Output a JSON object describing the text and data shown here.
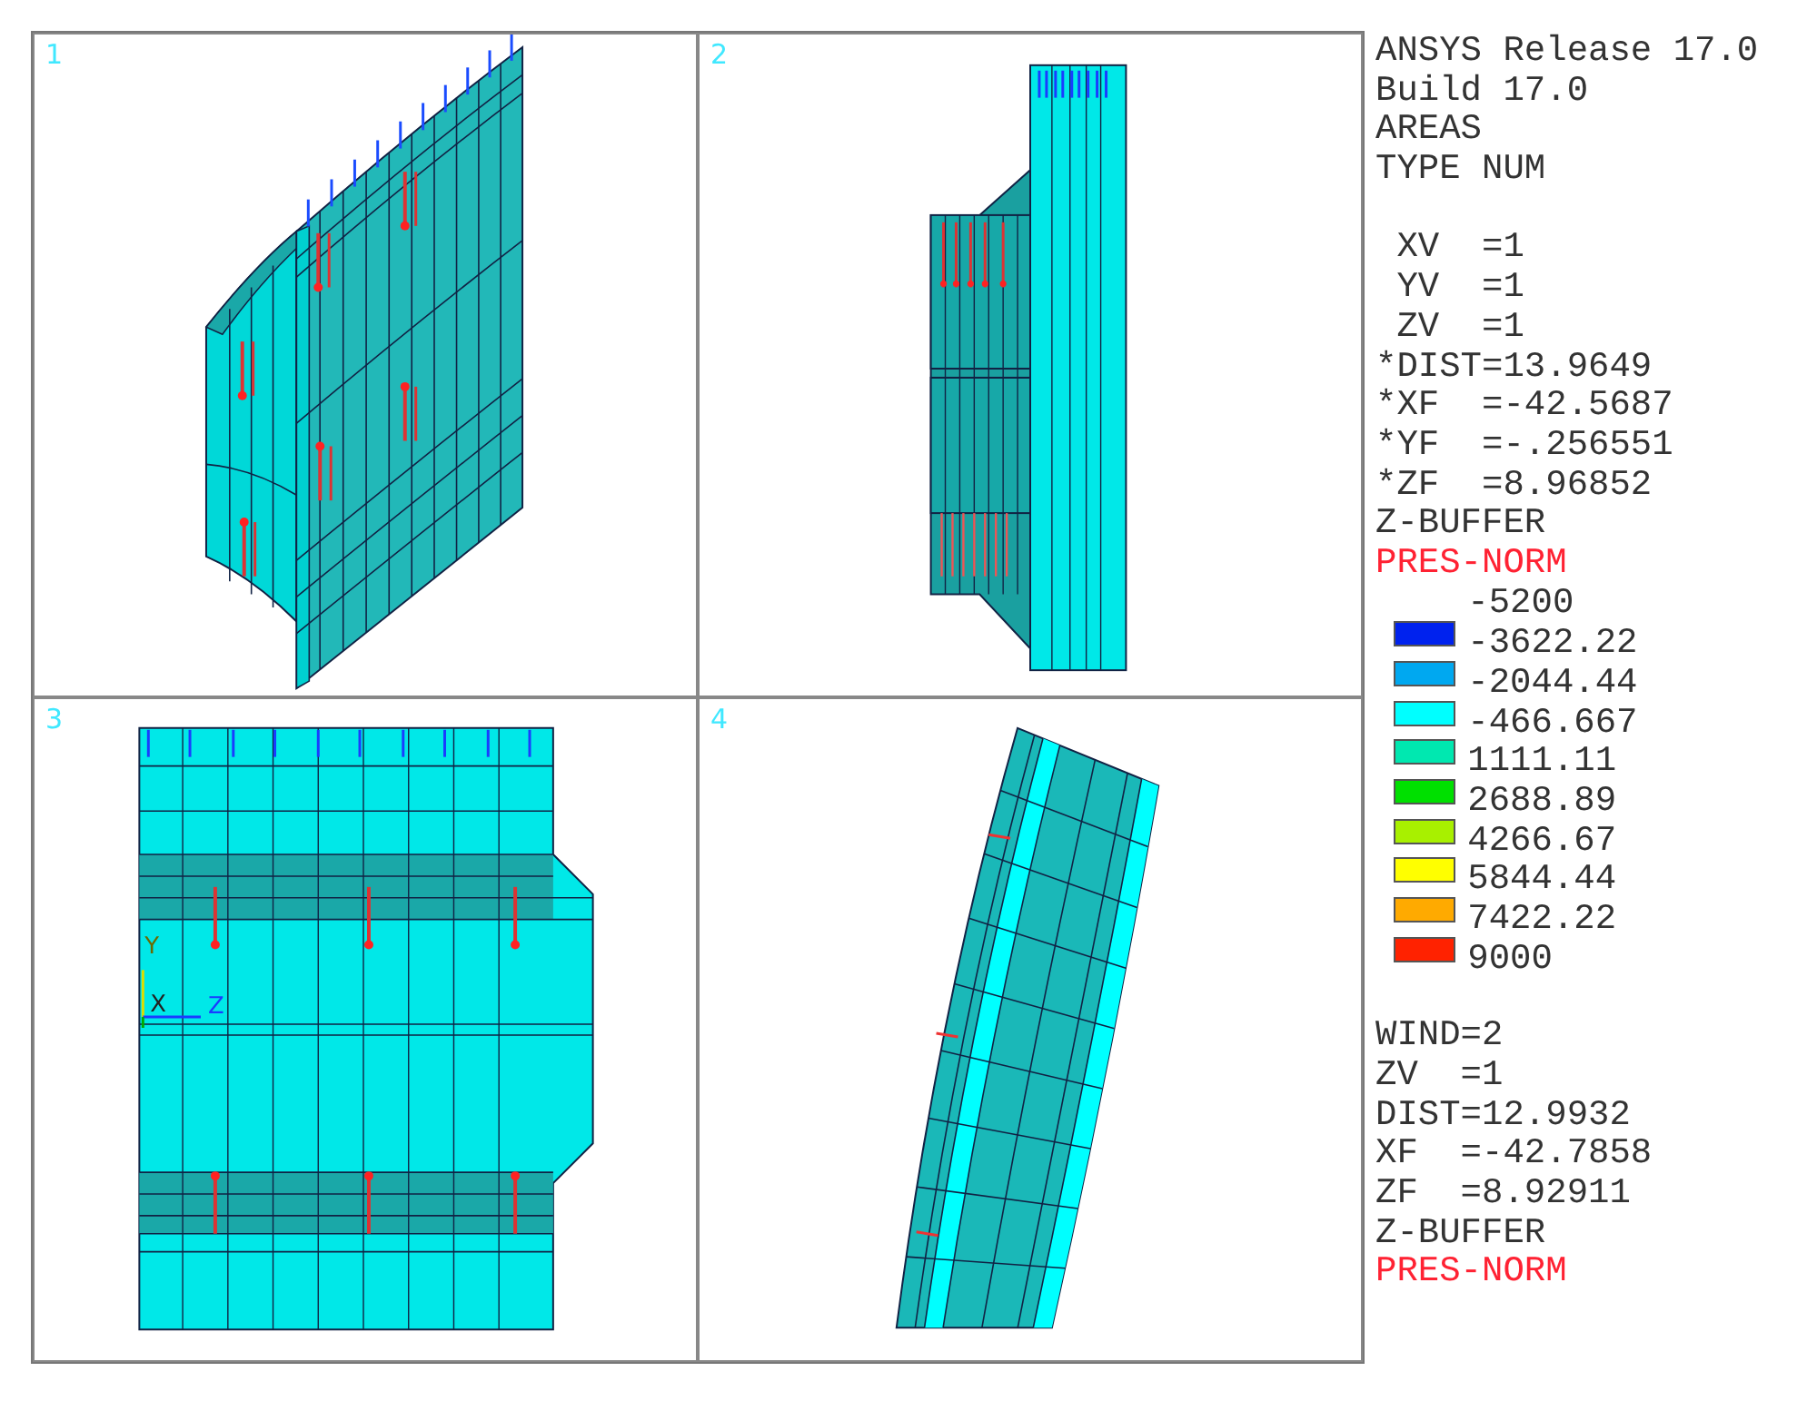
{
  "viewports": [
    {
      "number": "1",
      "kind": "iso"
    },
    {
      "number": "2",
      "kind": "side"
    },
    {
      "number": "3",
      "kind": "front",
      "triad": {
        "y": "Y",
        "x": "X",
        "z": "Z"
      }
    },
    {
      "number": "4",
      "kind": "top"
    }
  ],
  "info": {
    "header": [
      "ANSYS Release 17.0",
      "Build 17.0",
      "AREAS",
      "TYPE NUM"
    ],
    "view_lines": [
      " XV  =1",
      " YV  =1",
      " ZV  =1",
      "*DIST=13.9649",
      "*XF  =-42.5687",
      "*YF  =-.256551",
      "*ZF  =8.96852"
    ],
    "zbuffer": "Z-BUFFER",
    "load_label": "PRES-NORM"
  },
  "legend": {
    "top_value": "-5200",
    "bands": [
      {
        "color": "#0022ee",
        "value": "-3622.22"
      },
      {
        "color": "#00a8f0",
        "value": "-2044.44"
      },
      {
        "color": "#00ffff",
        "value": "-466.667"
      },
      {
        "color": "#00e8b0",
        "value": "1111.11"
      },
      {
        "color": "#00e000",
        "value": "2688.89"
      },
      {
        "color": "#a8f000",
        "value": "4266.67"
      },
      {
        "color": "#ffff00",
        "value": "5844.44"
      },
      {
        "color": "#ffaa00",
        "value": "7422.22"
      },
      {
        "color": "#ff2200",
        "value": "9000"
      }
    ]
  },
  "window2": {
    "lines": [
      "WIND=2",
      "ZV  =1",
      "DIST=12.9932",
      "XF  =-42.7858",
      "ZF  =8.92911"
    ],
    "zbuffer": "Z-BUFFER",
    "load_label": "PRES-NORM"
  }
}
